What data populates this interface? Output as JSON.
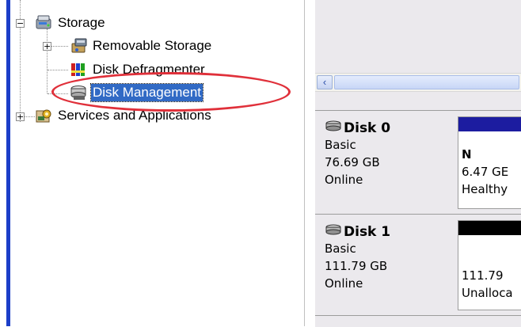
{
  "tree": {
    "items": [
      {
        "label": "Storage",
        "expander": "−"
      },
      {
        "label": "Removable Storage",
        "expander": "+"
      },
      {
        "label": "Disk Defragmenter"
      },
      {
        "label": "Disk Management"
      },
      {
        "label": "Services and Applications",
        "expander": "+"
      }
    ]
  },
  "scrollbar": {
    "left_arrow": "‹"
  },
  "disks": [
    {
      "name": "Disk 0",
      "type": "Basic",
      "size": "76.69 GB",
      "status": "Online",
      "partition": {
        "line1": "N",
        "line2": "6.47 GE",
        "line3": "Healthy",
        "bar_color": "#1c1ca0"
      }
    },
    {
      "name": "Disk 1",
      "type": "Basic",
      "size": "111.79 GB",
      "status": "Online",
      "partition": {
        "line1": "",
        "line2": "111.79",
        "line3": "Unalloca",
        "bar_color": "#000000"
      }
    }
  ],
  "colors": {
    "selection": "#316ac5",
    "highlight_ring": "#e0303a",
    "left_bar": "#1c3ec8"
  }
}
